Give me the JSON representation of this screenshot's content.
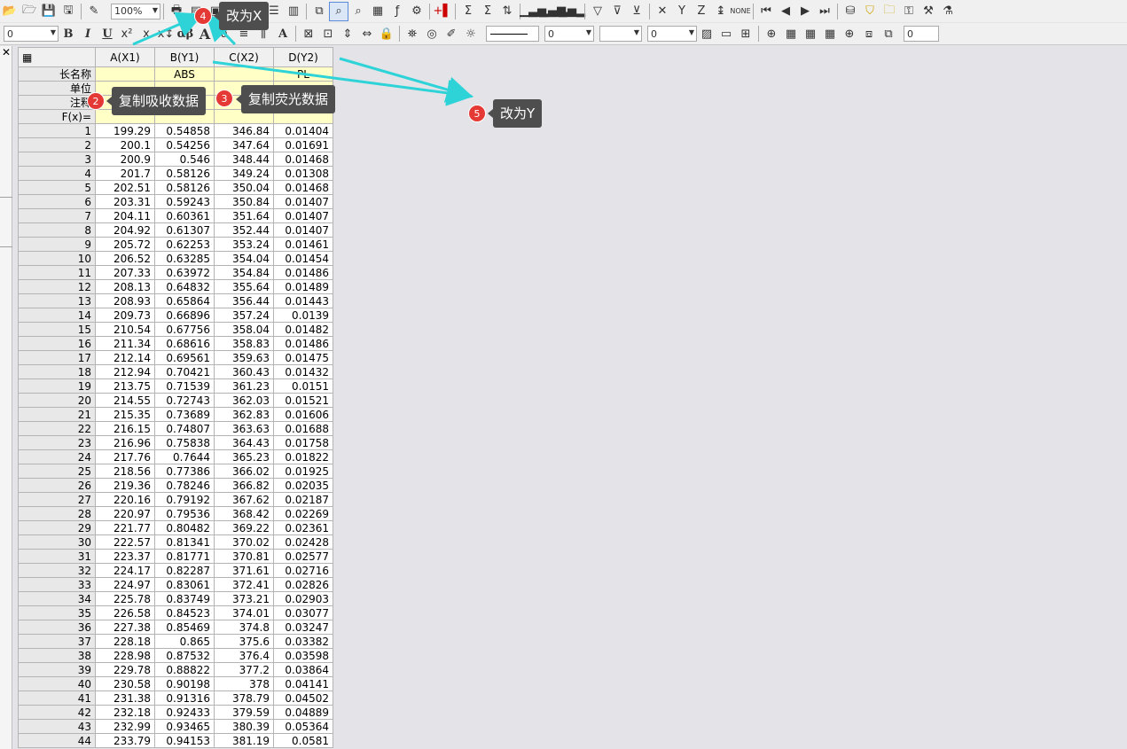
{
  "toolbar1": {
    "zoom": "100%",
    "items": [
      "open-icon",
      "open-folder-icon",
      "save-icon",
      "save-all-icon",
      "wand-icon",
      "print-icon",
      "new-worksheet-icon",
      "new-graph-icon",
      "matrix-icon",
      "layout-icon",
      "column-icon",
      "rows-icon",
      "tree-icon",
      "zoom-icon",
      "zoom-select-icon",
      "table-icon",
      "function-icon",
      "gear-icon",
      "add-column-icon",
      "statistics-icon",
      "sum-icon",
      "sort-icon",
      "bar-chart-icon",
      "column-chart-icon",
      "filter-icon",
      "clear-icon",
      "x-icon",
      "y-icon",
      "z-icon",
      "move-icon",
      "none-icon",
      "first-icon",
      "prev-icon",
      "next-icon",
      "last-icon"
    ]
  },
  "toolbar2": {
    "font_size": "0",
    "bold": "B",
    "italic": "I",
    "underline": "U",
    "superscript": "x²",
    "subscript": "x",
    "greek": "αβ",
    "big_a": "A",
    "line_width": "0",
    "line_style": "0",
    "fill": "0",
    "last": "0"
  },
  "sheet": {
    "corner": "▦",
    "columns": [
      "A(X1)",
      "B(Y1)",
      "C(X2)",
      "D(Y2)"
    ],
    "meta_labels": [
      "长名称",
      "单位",
      "注释",
      "F(x)="
    ],
    "long_names": [
      "",
      "ABS",
      "",
      "PL"
    ],
    "rows": [
      [
        "1",
        "199.29",
        "0.54858",
        "346.84",
        "0.01404"
      ],
      [
        "2",
        "200.1",
        "0.54256",
        "347.64",
        "0.01691"
      ],
      [
        "3",
        "200.9",
        "0.546",
        "348.44",
        "0.01468"
      ],
      [
        "4",
        "201.7",
        "0.58126",
        "349.24",
        "0.01308"
      ],
      [
        "5",
        "202.51",
        "0.58126",
        "350.04",
        "0.01468"
      ],
      [
        "6",
        "203.31",
        "0.59243",
        "350.84",
        "0.01407"
      ],
      [
        "7",
        "204.11",
        "0.60361",
        "351.64",
        "0.01407"
      ],
      [
        "8",
        "204.92",
        "0.61307",
        "352.44",
        "0.01407"
      ],
      [
        "9",
        "205.72",
        "0.62253",
        "353.24",
        "0.01461"
      ],
      [
        "10",
        "206.52",
        "0.63285",
        "354.04",
        "0.01454"
      ],
      [
        "11",
        "207.33",
        "0.63972",
        "354.84",
        "0.01486"
      ],
      [
        "12",
        "208.13",
        "0.64832",
        "355.64",
        "0.01489"
      ],
      [
        "13",
        "208.93",
        "0.65864",
        "356.44",
        "0.01443"
      ],
      [
        "14",
        "209.73",
        "0.66896",
        "357.24",
        "0.0139"
      ],
      [
        "15",
        "210.54",
        "0.67756",
        "358.04",
        "0.01482"
      ],
      [
        "16",
        "211.34",
        "0.68616",
        "358.83",
        "0.01486"
      ],
      [
        "17",
        "212.14",
        "0.69561",
        "359.63",
        "0.01475"
      ],
      [
        "18",
        "212.94",
        "0.70421",
        "360.43",
        "0.01432"
      ],
      [
        "19",
        "213.75",
        "0.71539",
        "361.23",
        "0.0151"
      ],
      [
        "20",
        "214.55",
        "0.72743",
        "362.03",
        "0.01521"
      ],
      [
        "21",
        "215.35",
        "0.73689",
        "362.83",
        "0.01606"
      ],
      [
        "22",
        "216.15",
        "0.74807",
        "363.63",
        "0.01688"
      ],
      [
        "23",
        "216.96",
        "0.75838",
        "364.43",
        "0.01758"
      ],
      [
        "24",
        "217.76",
        "0.7644",
        "365.23",
        "0.01822"
      ],
      [
        "25",
        "218.56",
        "0.77386",
        "366.02",
        "0.01925"
      ],
      [
        "26",
        "219.36",
        "0.78246",
        "366.82",
        "0.02035"
      ],
      [
        "27",
        "220.16",
        "0.79192",
        "367.62",
        "0.02187"
      ],
      [
        "28",
        "220.97",
        "0.79536",
        "368.42",
        "0.02269"
      ],
      [
        "29",
        "221.77",
        "0.80482",
        "369.22",
        "0.02361"
      ],
      [
        "30",
        "222.57",
        "0.81341",
        "370.02",
        "0.02428"
      ],
      [
        "31",
        "223.37",
        "0.81771",
        "370.81",
        "0.02577"
      ],
      [
        "32",
        "224.17",
        "0.82287",
        "371.61",
        "0.02716"
      ],
      [
        "33",
        "224.97",
        "0.83061",
        "372.41",
        "0.02826"
      ],
      [
        "34",
        "225.78",
        "0.83749",
        "373.21",
        "0.02903"
      ],
      [
        "35",
        "226.58",
        "0.84523",
        "374.01",
        "0.03077"
      ],
      [
        "36",
        "227.38",
        "0.85469",
        "374.8",
        "0.03247"
      ],
      [
        "37",
        "228.18",
        "0.865",
        "375.6",
        "0.03382"
      ],
      [
        "38",
        "228.98",
        "0.87532",
        "376.4",
        "0.03598"
      ],
      [
        "39",
        "229.78",
        "0.88822",
        "377.2",
        "0.03864"
      ],
      [
        "40",
        "230.58",
        "0.90198",
        "378",
        "0.04141"
      ],
      [
        "41",
        "231.38",
        "0.91316",
        "378.79",
        "0.04502"
      ],
      [
        "42",
        "232.18",
        "0.92433",
        "379.59",
        "0.04889"
      ],
      [
        "43",
        "232.99",
        "0.93465",
        "380.39",
        "0.05364"
      ],
      [
        "44",
        "233.79",
        "0.94153",
        "381.19",
        "0.0581"
      ]
    ]
  },
  "annotations": {
    "step2": {
      "num": "2",
      "text": "复制吸收数据"
    },
    "step3": {
      "num": "3",
      "text": "复制荧光数据"
    },
    "step4": {
      "num": "4",
      "text": "改为X"
    },
    "step5": {
      "num": "5",
      "text": "改为Y"
    },
    "arrow_color": "#2ed3d8"
  }
}
